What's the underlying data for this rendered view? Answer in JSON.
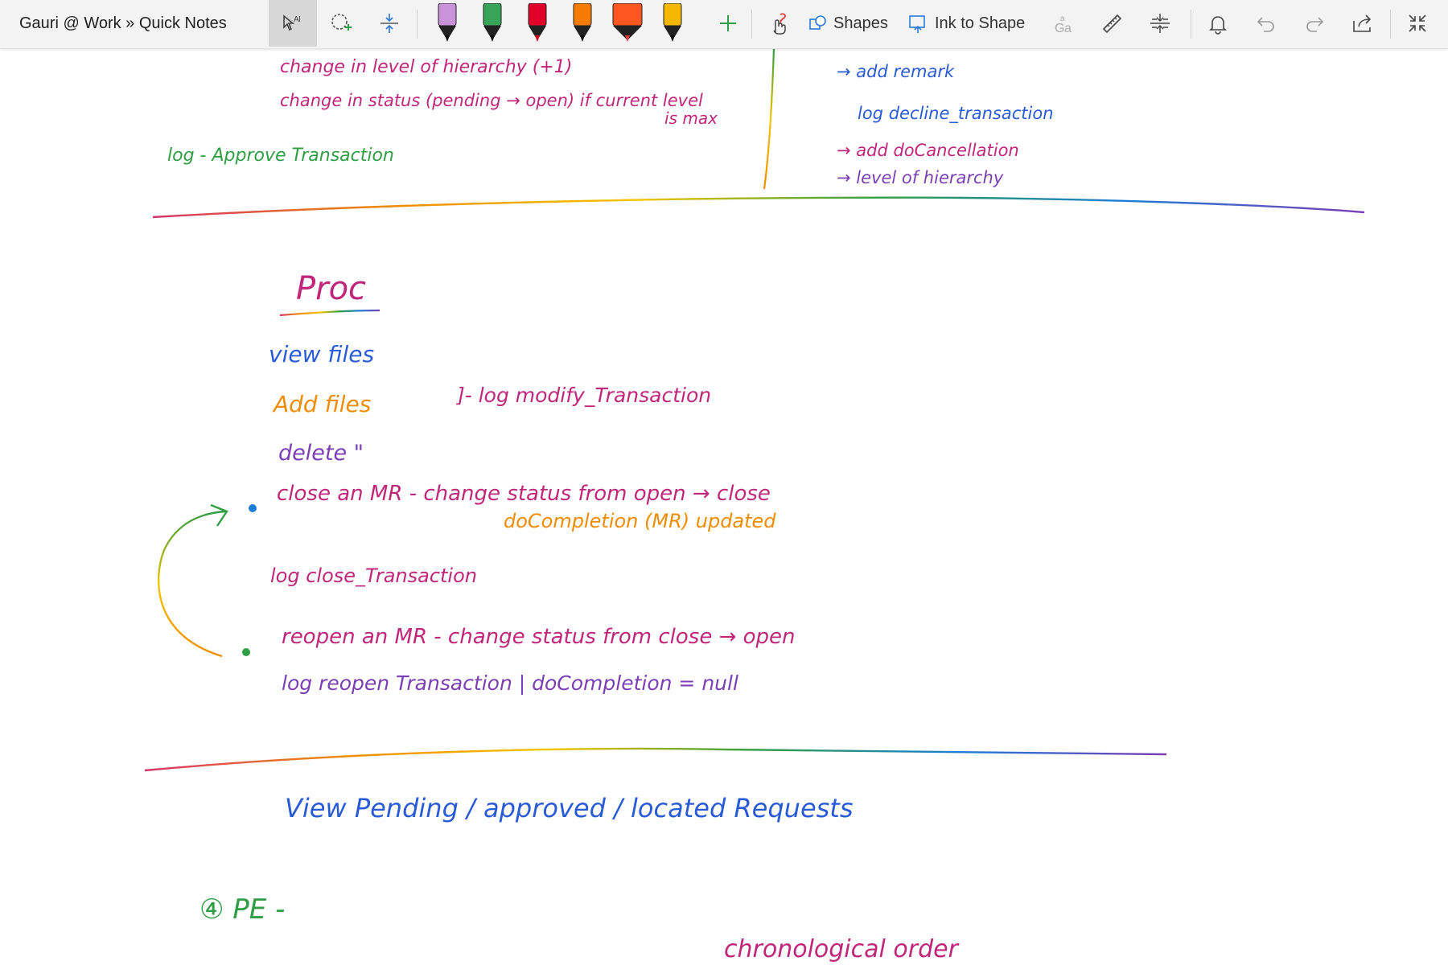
{
  "app": {
    "breadcrumb": "Gauri @ Work » Quick Notes"
  },
  "toolbar": {
    "select_tool_icon": "lasso-text-select-icon",
    "lasso_icon": "lasso-add-icon",
    "space_icon": "add-space-icon",
    "pens": [
      {
        "name": "pen-black-purple",
        "tip": "#111111",
        "body": "#c893d8"
      },
      {
        "name": "pen-rainbow",
        "tip": "#111111",
        "body": "#3aa35a"
      },
      {
        "name": "pen-red",
        "tip": "#d0021b",
        "body": "#e0002a"
      },
      {
        "name": "pen-orange-pattern",
        "tip": "#111111",
        "body": "#f57c00"
      },
      {
        "name": "highlighter-red-orange",
        "tip": "#e53935",
        "body": "#ff5722"
      },
      {
        "name": "pen-gold",
        "tip": "#111111",
        "body": "#f5b800"
      }
    ],
    "add_pen_icon": "plus-icon",
    "touch_draw_icon": "touch-drawing-icon",
    "shapes_label": "Shapes",
    "ink_to_shape_label": "Ink to Shape",
    "ink_to_text_icon": "ink-to-text-icon",
    "ruler_icon": "ruler-icon",
    "fit_icon": "fit-to-page-icon",
    "bell_icon": "bell-icon",
    "undo_icon": "undo-icon",
    "redo_icon": "redo-icon",
    "share_icon": "share-icon",
    "collapse_icon": "collapse-icon"
  },
  "notes": {
    "top_left": {
      "line1": "change in level of hierarchy (+1)",
      "line2": "change in status (pending → open) if current level",
      "line2b": "is max",
      "log": "log - Approve Transaction"
    },
    "top_right": {
      "line1": "→ add remark",
      "line2": "log decline_transaction",
      "line3": "→ add doCancellation",
      "line4": "→ level of hierarchy"
    },
    "proc": {
      "title": "Proc",
      "view_files": "view files",
      "add_files": "Add files",
      "delete": "delete \"",
      "log_modify": "]- log modify_Transaction",
      "close_mr": "close an MR - change status from open → close",
      "close_mr2": "doCompletion (MR) updated",
      "log_close": "log close_Transaction",
      "reopen_mr": "reopen an MR - change status from close → open",
      "log_reopen": "log reopen Transaction | doCompletion = null"
    },
    "bottom": {
      "requests": "View Pending / approved / located Requests",
      "pe": "④ PE -",
      "chrono": "chronological order"
    }
  },
  "colors": {
    "toolbar_bg": "#f3f3f3",
    "accent": "#2b7bd6",
    "ink_magenta": "#c0267a",
    "ink_green": "#2f9e44",
    "ink_blue": "#2a5bd7",
    "ink_orange": "#e8790b",
    "ink_purple": "#7b3fb5"
  }
}
